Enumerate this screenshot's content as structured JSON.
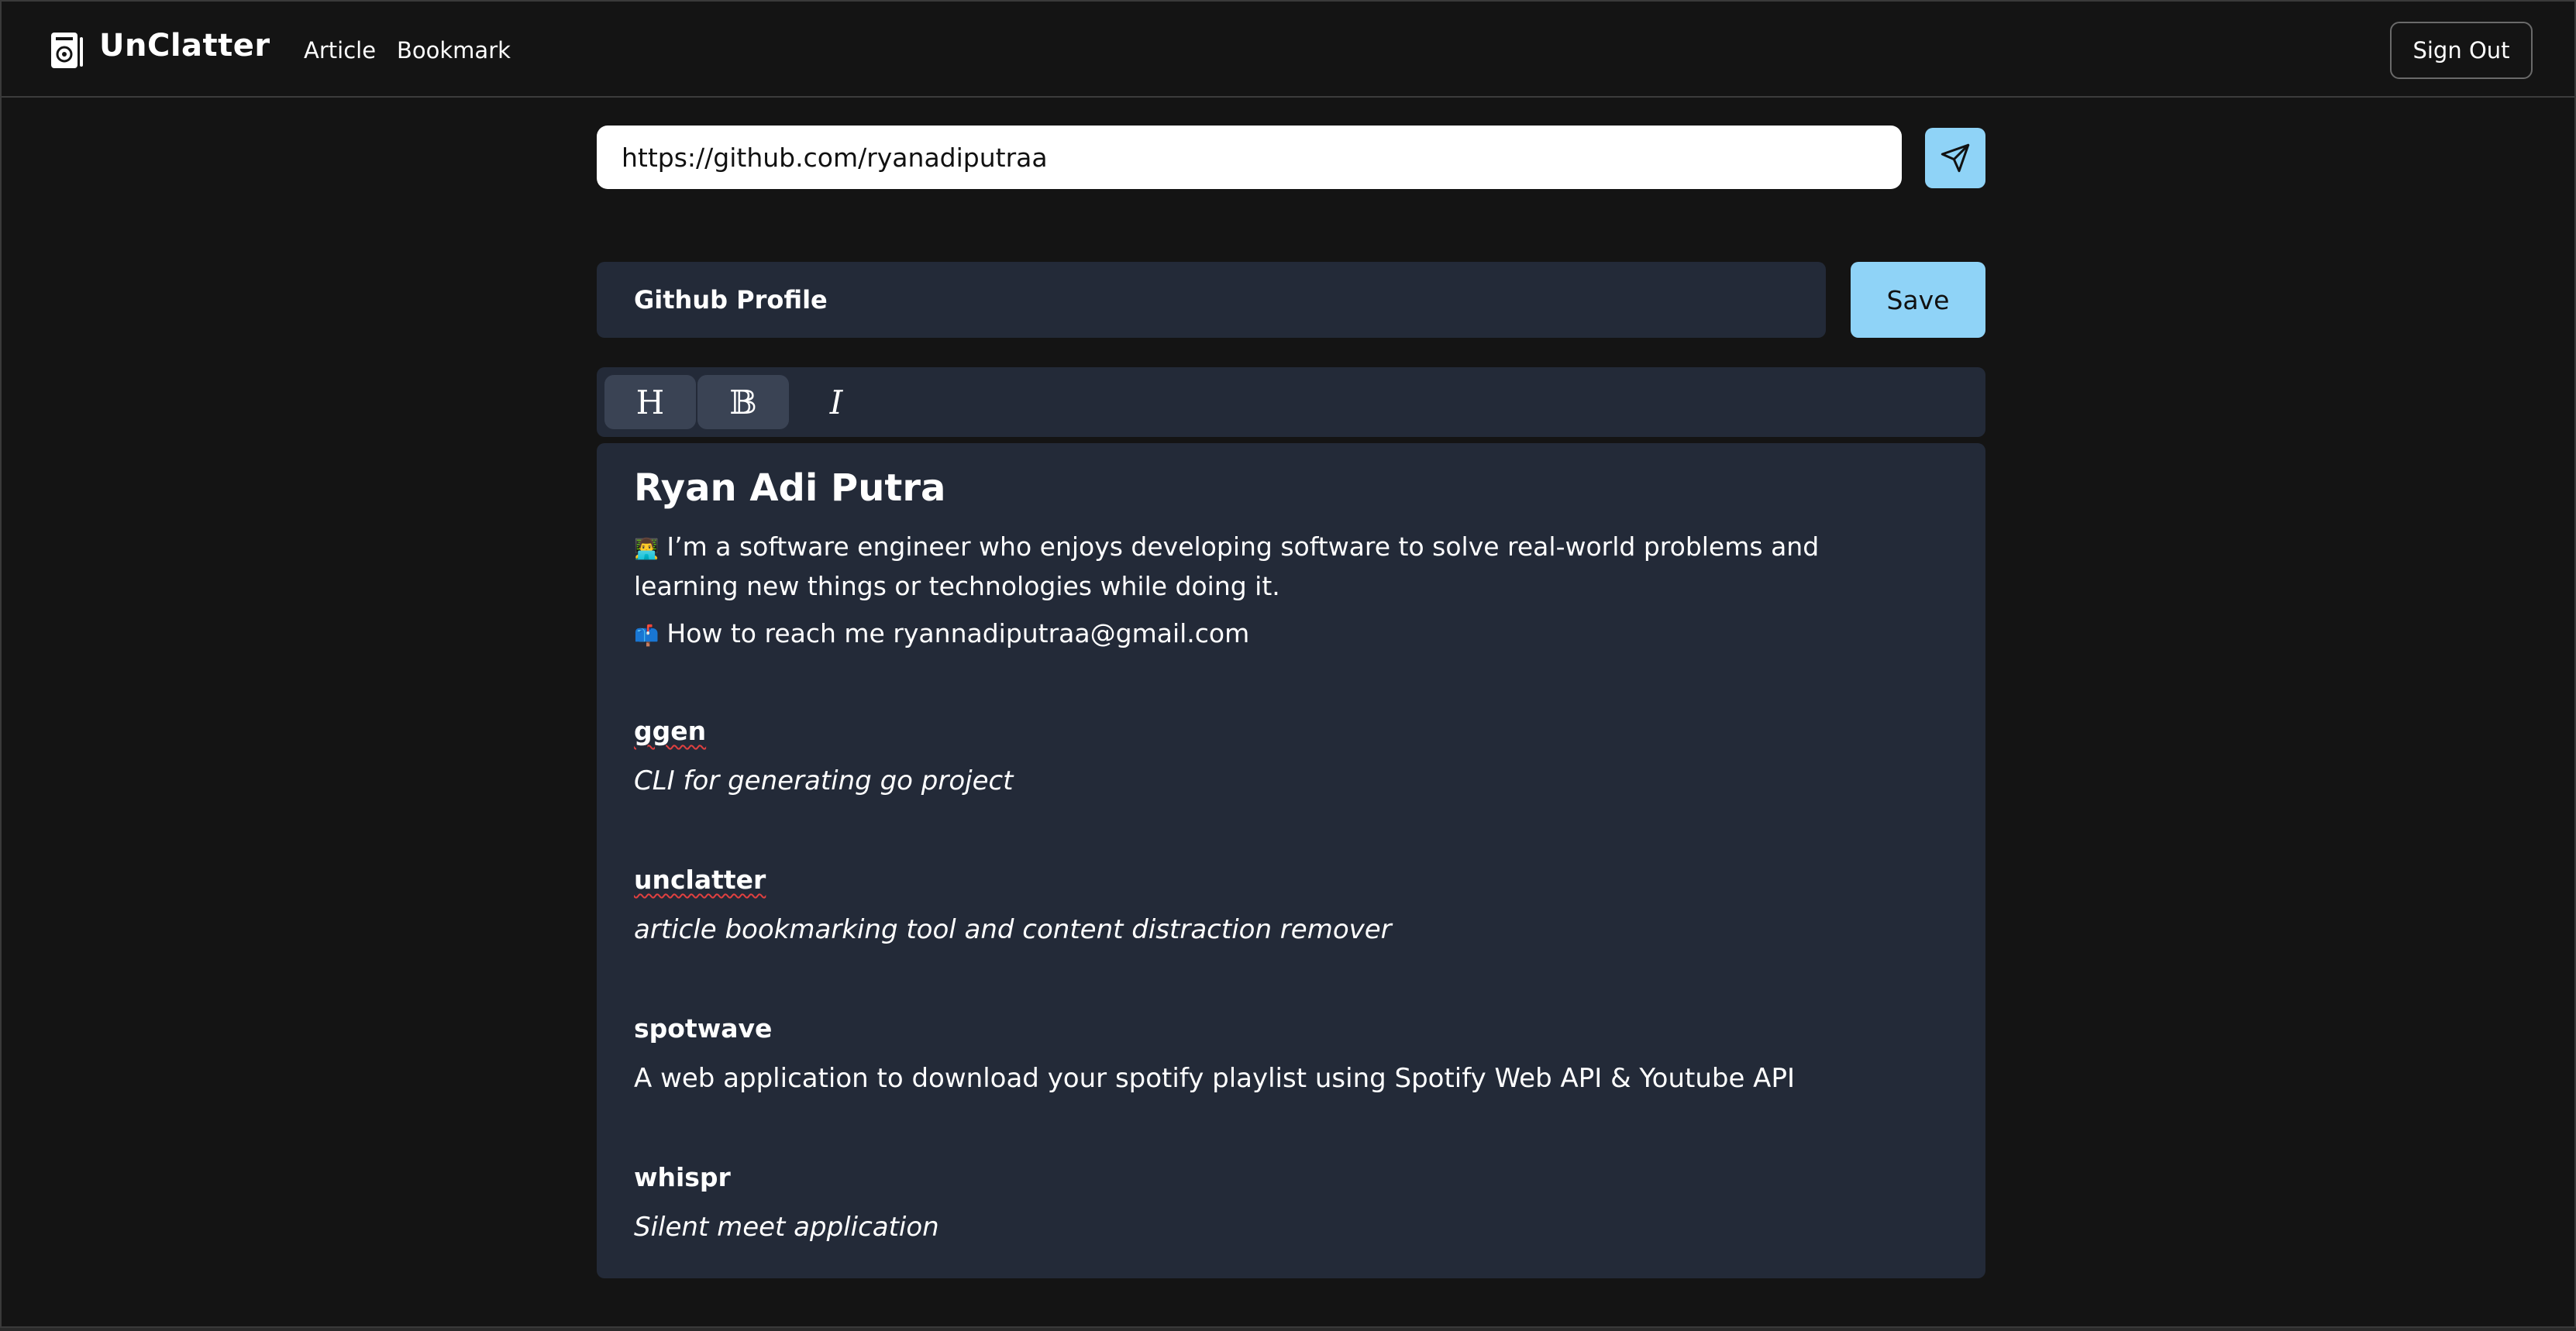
{
  "header": {
    "brand": "UnClatter",
    "nav": [
      "Article",
      "Bookmark"
    ],
    "signout_label": "Sign Out",
    "logo_icon": "newspaper-icon"
  },
  "url_bar": {
    "value": "https://github.com/ryanadiputraa",
    "send_icon": "send-icon"
  },
  "title_row": {
    "title": "Github Profile",
    "save_label": "Save"
  },
  "toolbar": {
    "heading": "H",
    "bold": "𝔹",
    "italic": "I"
  },
  "editor": {
    "heading": "Ryan Adi Putra",
    "bio_emoji": "👨‍💻",
    "bio": "I’m a software engineer who enjoys developing software to solve real-world problems and learning new things or technologies while doing it.",
    "contact_emoji": "📫",
    "contact": "How to reach me ryannadiputraa@gmail.com",
    "projects": [
      {
        "name": "ggen",
        "description": "CLI for generating go project"
      },
      {
        "name": "unclatter",
        "description": "article bookmarking tool and content distraction remover"
      },
      {
        "name": "spotwave",
        "description": "A web application to download your spotify playlist using Spotify Web API & Youtube API"
      },
      {
        "name": "whispr",
        "description": "Silent meet application"
      }
    ]
  },
  "colors": {
    "background": "#141414",
    "panel": "#232a38",
    "accent": "#8fd3f7"
  }
}
